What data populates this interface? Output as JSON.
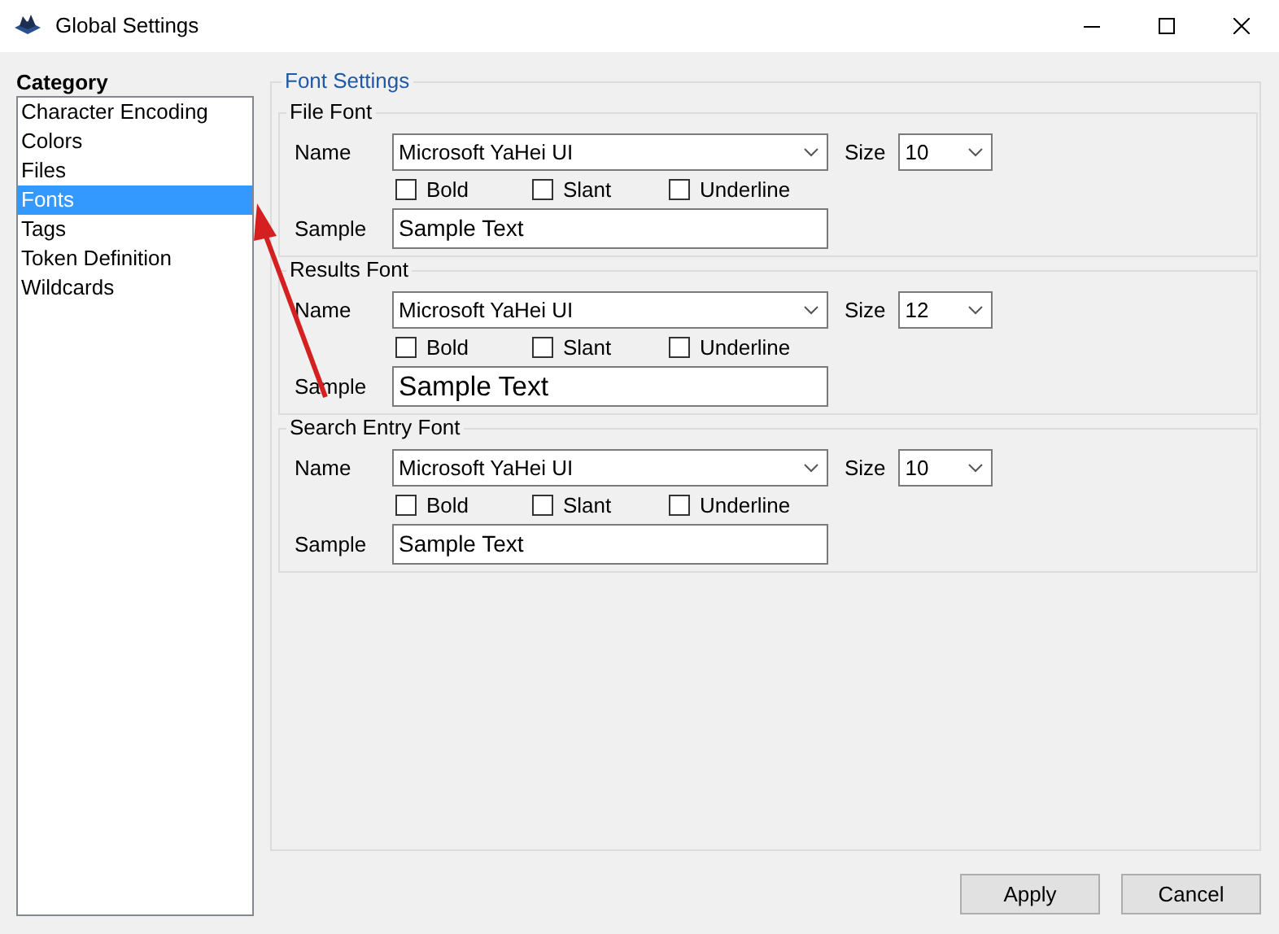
{
  "window": {
    "title": "Global Settings"
  },
  "category": {
    "label": "Category",
    "items": [
      {
        "label": "Character Encoding",
        "selected": false
      },
      {
        "label": "Colors",
        "selected": false
      },
      {
        "label": "Files",
        "selected": false
      },
      {
        "label": "Fonts",
        "selected": true
      },
      {
        "label": "Tags",
        "selected": false
      },
      {
        "label": "Token Definition",
        "selected": false
      },
      {
        "label": "Wildcards",
        "selected": false
      }
    ]
  },
  "font_settings": {
    "title": "Font Settings",
    "groups": [
      {
        "title": "File Font",
        "name_label": "Name",
        "name": "Microsoft YaHei UI",
        "size_label": "Size",
        "size": "10",
        "options": [
          {
            "label": "Bold",
            "checked": false
          },
          {
            "label": "Slant",
            "checked": false
          },
          {
            "label": "Underline",
            "checked": false
          }
        ],
        "sample_label": "Sample",
        "sample": "Sample Text"
      },
      {
        "title": "Results Font",
        "name_label": "Name",
        "name": "Microsoft YaHei UI",
        "size_label": "Size",
        "size": "12",
        "options": [
          {
            "label": "Bold",
            "checked": false
          },
          {
            "label": "Slant",
            "checked": false
          },
          {
            "label": "Underline",
            "checked": false
          }
        ],
        "sample_label": "Sample",
        "sample": "Sample Text"
      },
      {
        "title": "Search Entry Font",
        "name_label": "Name",
        "name": "Microsoft YaHei UI",
        "size_label": "Size",
        "size": "10",
        "options": [
          {
            "label": "Bold",
            "checked": false
          },
          {
            "label": "Slant",
            "checked": false
          },
          {
            "label": "Underline",
            "checked": false
          }
        ],
        "sample_label": "Sample",
        "sample": "Sample Text"
      }
    ]
  },
  "buttons": [
    "Apply",
    "Cancel"
  ]
}
